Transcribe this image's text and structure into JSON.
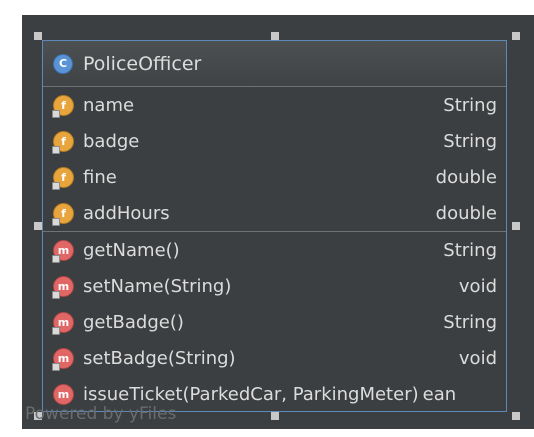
{
  "class": {
    "stereotype_icon": "C",
    "name": "PoliceOfficer"
  },
  "fields": [
    {
      "icon": "f",
      "name": "name",
      "type": "String"
    },
    {
      "icon": "f",
      "name": "badge",
      "type": "String"
    },
    {
      "icon": "f",
      "name": "fine",
      "type": "double"
    },
    {
      "icon": "f",
      "name": "addHours",
      "type": "double"
    }
  ],
  "methods": [
    {
      "icon": "m",
      "name": "getName()",
      "type": "String"
    },
    {
      "icon": "m",
      "name": "setName(String)",
      "type": "void"
    },
    {
      "icon": "m",
      "name": "getBadge()",
      "type": "String"
    },
    {
      "icon": "m",
      "name": "setBadge(String)",
      "type": "void"
    },
    {
      "icon": "m",
      "name": "issueTicket(ParkedCar, ParkingMeter)",
      "type": "ean"
    }
  ],
  "watermark": "Powered by yFiles",
  "colors": {
    "background": "#3c3f41",
    "border": "#5e88b5",
    "field_icon": "#e8a53e",
    "method_icon": "#e16666",
    "class_icon": "#5a93d6"
  }
}
